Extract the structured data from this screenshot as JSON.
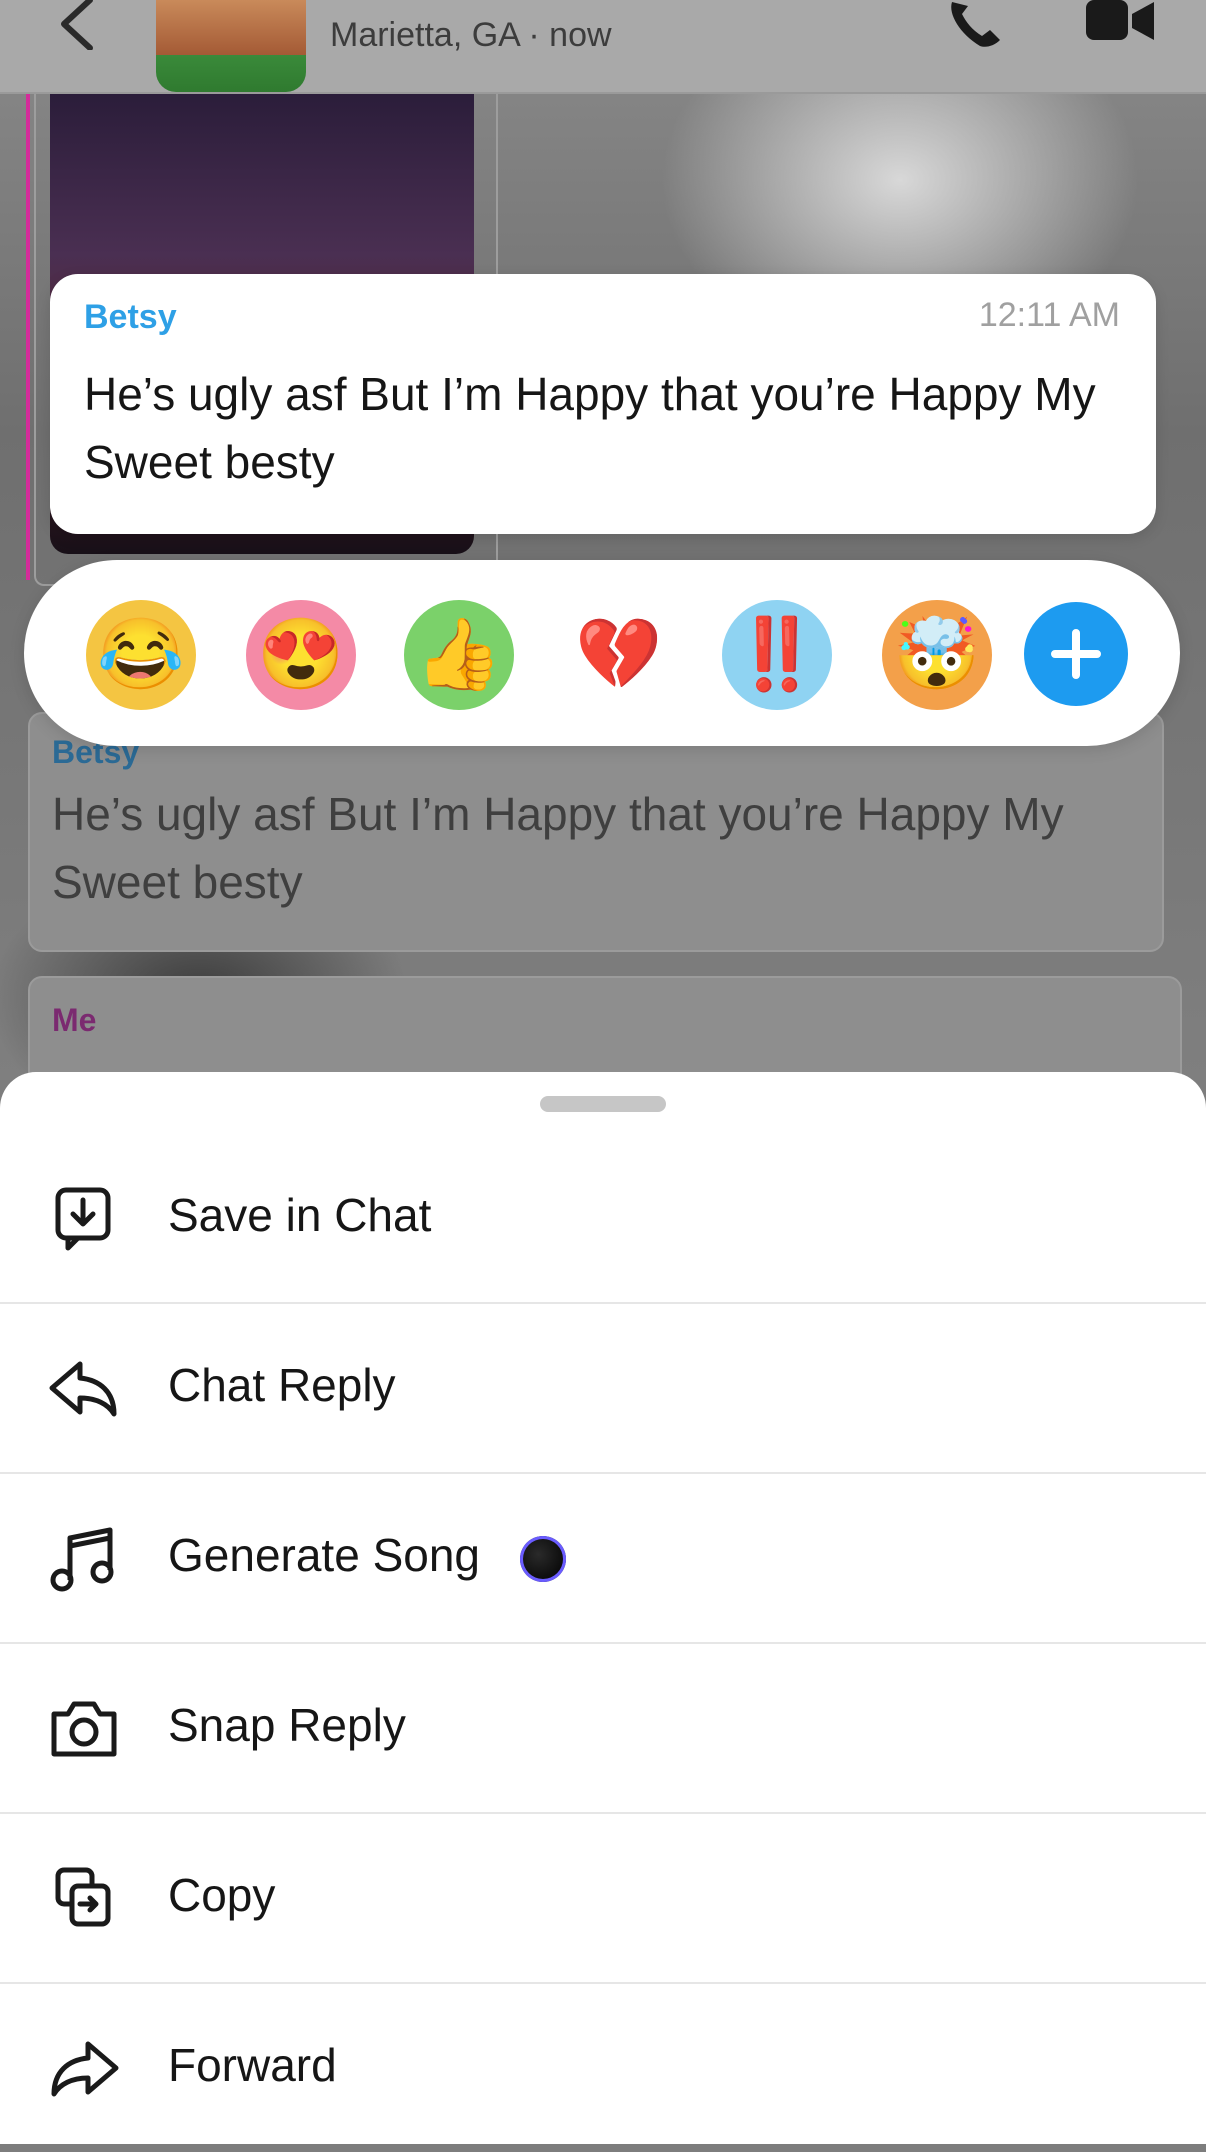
{
  "header": {
    "subtitle": "Marietta, GA · now",
    "icons": [
      "back-icon",
      "avatar",
      "call-icon",
      "video-call-icon"
    ]
  },
  "focused_message": {
    "sender": "Betsy",
    "time": "12:11 AM",
    "text": "He’s ugly asf But I’m Happy that you’re Happy My Sweet besty",
    "sender_color": "#2ea0e6"
  },
  "reactions": [
    {
      "name": "laughing-crying-bitmoji",
      "glyph": "😂"
    },
    {
      "name": "heart-bitmoji",
      "glyph": "😍"
    },
    {
      "name": "thumbs-up-bitmoji",
      "glyph": "👍"
    },
    {
      "name": "broken-heart",
      "glyph": "💔"
    },
    {
      "name": "exclamation-bitmoji",
      "glyph": "‼️"
    },
    {
      "name": "mind-blown-bitmoji",
      "glyph": "🤯"
    }
  ],
  "background_messages": [
    {
      "sender": "Betsy",
      "text": "He’s ugly asf But I’m Happy that you’re Happy My Sweet besty"
    },
    {
      "sender": "Me"
    }
  ],
  "menu": {
    "items": [
      {
        "label": "Save in Chat",
        "icon": "save-in-chat-icon"
      },
      {
        "label": "Chat Reply",
        "icon": "reply-icon"
      },
      {
        "label": "Generate Song",
        "icon": "music-note-icon"
      },
      {
        "label": "Snap Reply",
        "icon": "camera-icon"
      },
      {
        "label": "Copy",
        "icon": "copy-icon"
      },
      {
        "label": "Forward",
        "icon": "forward-icon"
      }
    ]
  },
  "colors": {
    "accent_blue": "#1d9bf0",
    "me_color": "#7b2a70",
    "media_border": "#d42c9a"
  }
}
